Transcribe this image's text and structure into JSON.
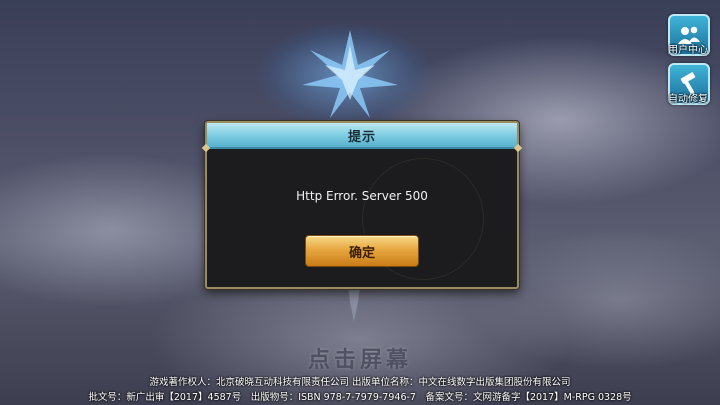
{
  "side_buttons": [
    {
      "label": "用户中心",
      "icon": "user-center-icon"
    },
    {
      "label": "自动修复",
      "icon": "hammer-icon"
    }
  ],
  "dialog": {
    "title": "提示",
    "message": "Http Error. Server 500",
    "confirm_label": "确定"
  },
  "tap_prompt": "点击屏幕",
  "footer": {
    "line1": "游戏著作权人：北京破晓互动科技有限责任公司 出版单位名称：中文在线数字出版集团股份有限公司",
    "line2": "批文号：新广出审【2017】4587号　出版物号：ISBN 978-7-7979-7946-7　备案文号：文网游备字【2017】M-RPG 0328号"
  },
  "colors": {
    "dialog_header": "#7fcde2",
    "button_gold": "#e7a740",
    "side_button": "#1d6f9a"
  }
}
